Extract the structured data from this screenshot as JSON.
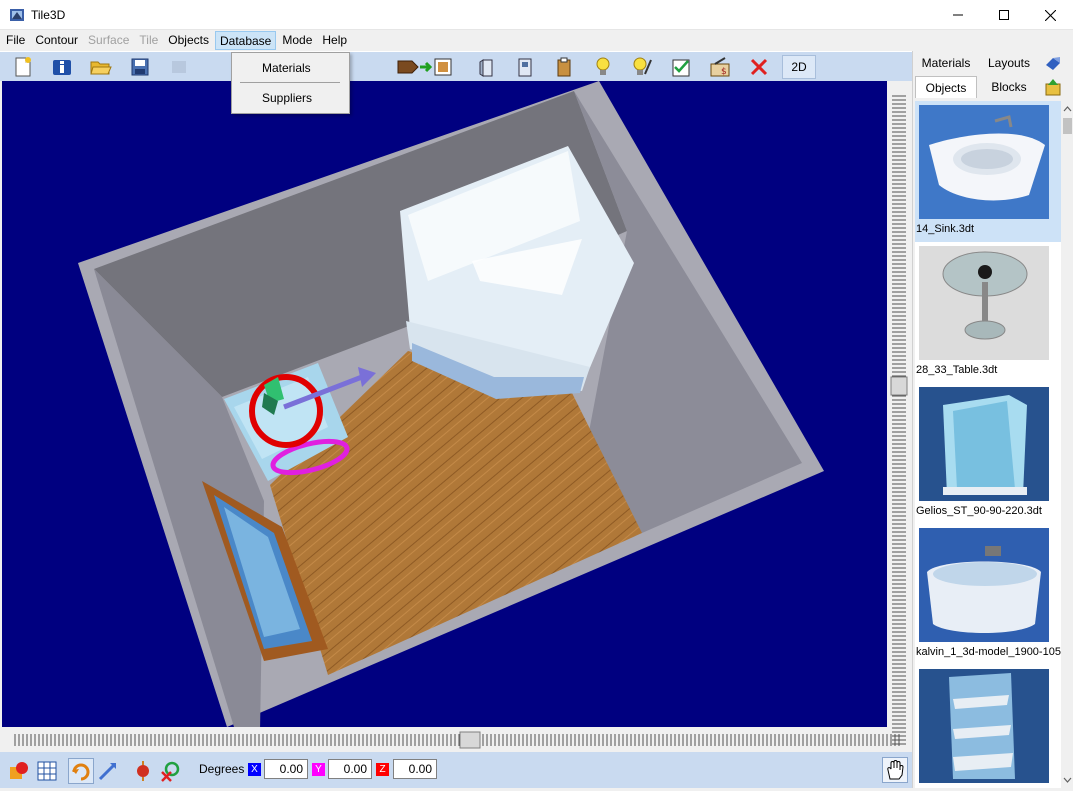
{
  "window": {
    "title": "Tile3D"
  },
  "menu": {
    "items": [
      {
        "label": "File",
        "state": "normal"
      },
      {
        "label": "Contour",
        "state": "normal"
      },
      {
        "label": "Surface",
        "state": "disabled"
      },
      {
        "label": "Tile",
        "state": "disabled"
      },
      {
        "label": "Objects",
        "state": "normal"
      },
      {
        "label": "Database",
        "state": "active"
      },
      {
        "label": "Mode",
        "state": "normal"
      },
      {
        "label": "Help",
        "state": "normal"
      }
    ]
  },
  "dropdown": {
    "items": [
      "Materials",
      "Suppliers"
    ]
  },
  "toolbar": {
    "icons": [
      "new-document-icon",
      "info-icon",
      "open-folder-icon",
      "save-icon",
      "export-icon",
      "insert-door-icon",
      "add-object-icon",
      "move-object-icon",
      "paste-icon",
      "light-bulb-icon",
      "light-settings-icon",
      "checklist-icon",
      "price-calc-icon",
      "delete-icon"
    ],
    "mode_label": "2D"
  },
  "bottom": {
    "degrees_label": "Degrees",
    "axes": [
      {
        "name": "X",
        "value": "0.00",
        "color": "#0000ff"
      },
      {
        "name": "Y",
        "value": "0.00",
        "color": "#ff00ff"
      },
      {
        "name": "Z",
        "value": "0.00",
        "color": "#ff0000"
      }
    ]
  },
  "panel": {
    "tabs_row1": [
      "Materials",
      "Layouts"
    ],
    "tabs_row2": [
      "Objects",
      "Blocks"
    ],
    "selected_tab": "Objects",
    "objects": [
      {
        "caption": "14_Sink.3dt",
        "selected": true
      },
      {
        "caption": "28_33_Table.3dt",
        "selected": false
      },
      {
        "caption": "Gelios_ST_90-90-220.3dt",
        "selected": false
      },
      {
        "caption": "kalvin_1_3d-model_1900-105",
        "selected": false
      },
      {
        "caption": "",
        "selected": false
      }
    ]
  },
  "colors": {
    "viewport": "#000080",
    "toolbar": "#c9daf0",
    "selection": "#cde2f7"
  }
}
